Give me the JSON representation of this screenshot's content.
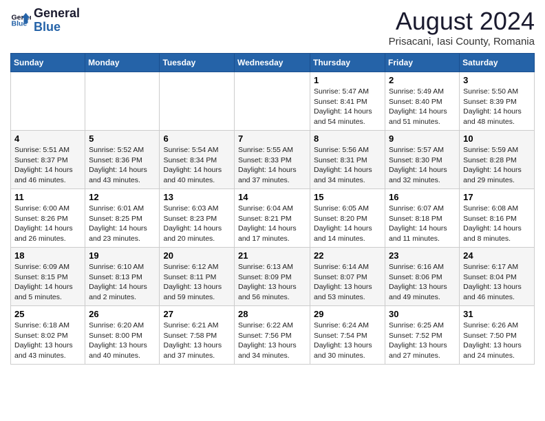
{
  "header": {
    "logo_text_general": "General",
    "logo_text_blue": "Blue",
    "month_year": "August 2024",
    "location": "Prisacani, Iasi County, Romania"
  },
  "days_of_week": [
    "Sunday",
    "Monday",
    "Tuesday",
    "Wednesday",
    "Thursday",
    "Friday",
    "Saturday"
  ],
  "weeks": [
    [
      {
        "day": "",
        "info": ""
      },
      {
        "day": "",
        "info": ""
      },
      {
        "day": "",
        "info": ""
      },
      {
        "day": "",
        "info": ""
      },
      {
        "day": "1",
        "info": "Sunrise: 5:47 AM\nSunset: 8:41 PM\nDaylight: 14 hours\nand 54 minutes."
      },
      {
        "day": "2",
        "info": "Sunrise: 5:49 AM\nSunset: 8:40 PM\nDaylight: 14 hours\nand 51 minutes."
      },
      {
        "day": "3",
        "info": "Sunrise: 5:50 AM\nSunset: 8:39 PM\nDaylight: 14 hours\nand 48 minutes."
      }
    ],
    [
      {
        "day": "4",
        "info": "Sunrise: 5:51 AM\nSunset: 8:37 PM\nDaylight: 14 hours\nand 46 minutes."
      },
      {
        "day": "5",
        "info": "Sunrise: 5:52 AM\nSunset: 8:36 PM\nDaylight: 14 hours\nand 43 minutes."
      },
      {
        "day": "6",
        "info": "Sunrise: 5:54 AM\nSunset: 8:34 PM\nDaylight: 14 hours\nand 40 minutes."
      },
      {
        "day": "7",
        "info": "Sunrise: 5:55 AM\nSunset: 8:33 PM\nDaylight: 14 hours\nand 37 minutes."
      },
      {
        "day": "8",
        "info": "Sunrise: 5:56 AM\nSunset: 8:31 PM\nDaylight: 14 hours\nand 34 minutes."
      },
      {
        "day": "9",
        "info": "Sunrise: 5:57 AM\nSunset: 8:30 PM\nDaylight: 14 hours\nand 32 minutes."
      },
      {
        "day": "10",
        "info": "Sunrise: 5:59 AM\nSunset: 8:28 PM\nDaylight: 14 hours\nand 29 minutes."
      }
    ],
    [
      {
        "day": "11",
        "info": "Sunrise: 6:00 AM\nSunset: 8:26 PM\nDaylight: 14 hours\nand 26 minutes."
      },
      {
        "day": "12",
        "info": "Sunrise: 6:01 AM\nSunset: 8:25 PM\nDaylight: 14 hours\nand 23 minutes."
      },
      {
        "day": "13",
        "info": "Sunrise: 6:03 AM\nSunset: 8:23 PM\nDaylight: 14 hours\nand 20 minutes."
      },
      {
        "day": "14",
        "info": "Sunrise: 6:04 AM\nSunset: 8:21 PM\nDaylight: 14 hours\nand 17 minutes."
      },
      {
        "day": "15",
        "info": "Sunrise: 6:05 AM\nSunset: 8:20 PM\nDaylight: 14 hours\nand 14 minutes."
      },
      {
        "day": "16",
        "info": "Sunrise: 6:07 AM\nSunset: 8:18 PM\nDaylight: 14 hours\nand 11 minutes."
      },
      {
        "day": "17",
        "info": "Sunrise: 6:08 AM\nSunset: 8:16 PM\nDaylight: 14 hours\nand 8 minutes."
      }
    ],
    [
      {
        "day": "18",
        "info": "Sunrise: 6:09 AM\nSunset: 8:15 PM\nDaylight: 14 hours\nand 5 minutes."
      },
      {
        "day": "19",
        "info": "Sunrise: 6:10 AM\nSunset: 8:13 PM\nDaylight: 14 hours\nand 2 minutes."
      },
      {
        "day": "20",
        "info": "Sunrise: 6:12 AM\nSunset: 8:11 PM\nDaylight: 13 hours\nand 59 minutes."
      },
      {
        "day": "21",
        "info": "Sunrise: 6:13 AM\nSunset: 8:09 PM\nDaylight: 13 hours\nand 56 minutes."
      },
      {
        "day": "22",
        "info": "Sunrise: 6:14 AM\nSunset: 8:07 PM\nDaylight: 13 hours\nand 53 minutes."
      },
      {
        "day": "23",
        "info": "Sunrise: 6:16 AM\nSunset: 8:06 PM\nDaylight: 13 hours\nand 49 minutes."
      },
      {
        "day": "24",
        "info": "Sunrise: 6:17 AM\nSunset: 8:04 PM\nDaylight: 13 hours\nand 46 minutes."
      }
    ],
    [
      {
        "day": "25",
        "info": "Sunrise: 6:18 AM\nSunset: 8:02 PM\nDaylight: 13 hours\nand 43 minutes."
      },
      {
        "day": "26",
        "info": "Sunrise: 6:20 AM\nSunset: 8:00 PM\nDaylight: 13 hours\nand 40 minutes."
      },
      {
        "day": "27",
        "info": "Sunrise: 6:21 AM\nSunset: 7:58 PM\nDaylight: 13 hours\nand 37 minutes."
      },
      {
        "day": "28",
        "info": "Sunrise: 6:22 AM\nSunset: 7:56 PM\nDaylight: 13 hours\nand 34 minutes."
      },
      {
        "day": "29",
        "info": "Sunrise: 6:24 AM\nSunset: 7:54 PM\nDaylight: 13 hours\nand 30 minutes."
      },
      {
        "day": "30",
        "info": "Sunrise: 6:25 AM\nSunset: 7:52 PM\nDaylight: 13 hours\nand 27 minutes."
      },
      {
        "day": "31",
        "info": "Sunrise: 6:26 AM\nSunset: 7:50 PM\nDaylight: 13 hours\nand 24 minutes."
      }
    ]
  ]
}
